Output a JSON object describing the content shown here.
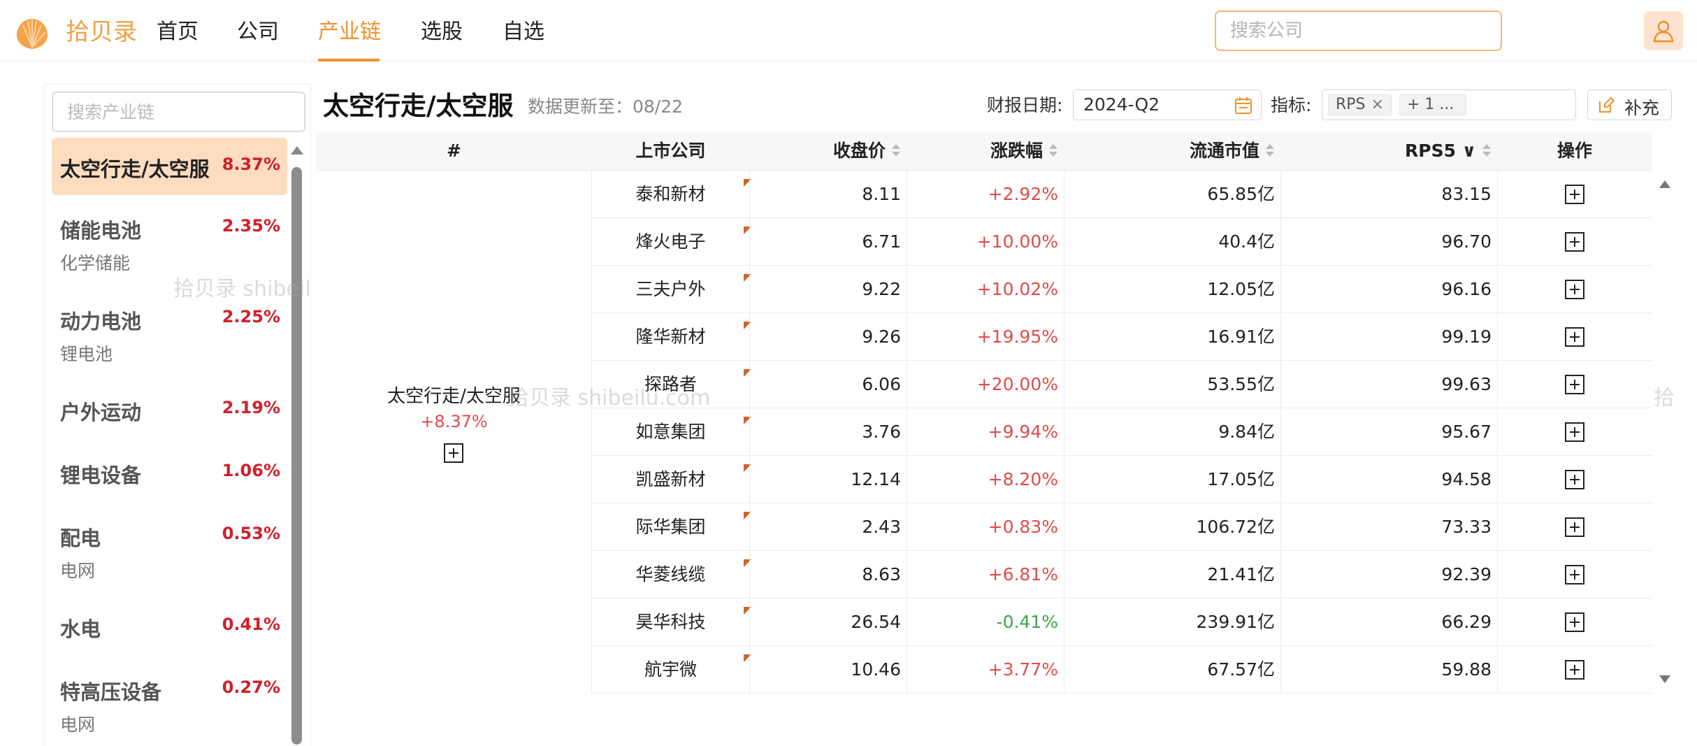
{
  "header": {
    "brand": "拾贝录",
    "nav": [
      "首页",
      "公司",
      "产业链",
      "选股",
      "自选"
    ],
    "active_nav": "产业链",
    "search_placeholder": "搜索公司",
    "accent_color": "#f0922e"
  },
  "sidebar": {
    "search_placeholder": "搜索产业链",
    "items": [
      {
        "name": "太空行走/太空服",
        "pct": "8.37%",
        "sub": "",
        "active": true
      },
      {
        "name": "储能电池",
        "pct": "2.35%",
        "sub": "化学储能"
      },
      {
        "name": "动力电池",
        "pct": "2.25%",
        "sub": "锂电池"
      },
      {
        "name": "户外运动",
        "pct": "2.19%",
        "sub": ""
      },
      {
        "name": "锂电设备",
        "pct": "1.06%",
        "sub": ""
      },
      {
        "name": "配电",
        "pct": "0.53%",
        "sub": "电网"
      },
      {
        "name": "水电",
        "pct": "0.41%",
        "sub": ""
      },
      {
        "name": "特高压设备",
        "pct": "0.27%",
        "sub": "电网"
      }
    ]
  },
  "watermarks": [
    "拾贝录 shibeilu",
    "拾贝录 shibeilu.com",
    "拾"
  ],
  "main": {
    "title": "太空行走/太空服",
    "update_label": "数据更新至：08/22",
    "report_date_label": "财报日期:",
    "report_date_value": "2024-Q2",
    "metric_label": "指标:",
    "metric_tags": [
      "RPS",
      "+ 1 ..."
    ],
    "tag_remove": "×",
    "supplement_label": "补充"
  },
  "table": {
    "columns": [
      "#",
      "上市公司",
      "收盘价",
      "涨跌幅",
      "流通市值",
      "RPS5 ∨",
      "操作"
    ],
    "group": {
      "name": "太空行走/太空服",
      "pct": "+8.37%"
    },
    "rows": [
      {
        "company": "泰和新材",
        "price": "8.11",
        "change": "+2.92%",
        "cap": "65.85亿",
        "rps": "83.15",
        "trend": "up"
      },
      {
        "company": "烽火电子",
        "price": "6.71",
        "change": "+10.00%",
        "cap": "40.4亿",
        "rps": "96.70",
        "trend": "up"
      },
      {
        "company": "三夫户外",
        "price": "9.22",
        "change": "+10.02%",
        "cap": "12.05亿",
        "rps": "96.16",
        "trend": "up"
      },
      {
        "company": "隆华新材",
        "price": "9.26",
        "change": "+19.95%",
        "cap": "16.91亿",
        "rps": "99.19",
        "trend": "up"
      },
      {
        "company": "探路者",
        "price": "6.06",
        "change": "+20.00%",
        "cap": "53.55亿",
        "rps": "99.63",
        "trend": "up"
      },
      {
        "company": "如意集团",
        "price": "3.76",
        "change": "+9.94%",
        "cap": "9.84亿",
        "rps": "95.67",
        "trend": "up"
      },
      {
        "company": "凯盛新材",
        "price": "12.14",
        "change": "+8.20%",
        "cap": "17.05亿",
        "rps": "94.58",
        "trend": "up"
      },
      {
        "company": "际华集团",
        "price": "2.43",
        "change": "+0.83%",
        "cap": "106.72亿",
        "rps": "73.33",
        "trend": "up"
      },
      {
        "company": "华菱线缆",
        "price": "8.63",
        "change": "+6.81%",
        "cap": "21.41亿",
        "rps": "92.39",
        "trend": "up"
      },
      {
        "company": "昊华科技",
        "price": "26.54",
        "change": "-0.41%",
        "cap": "239.91亿",
        "rps": "66.29",
        "trend": "down"
      },
      {
        "company": "航宇微",
        "price": "10.46",
        "change": "+3.77%",
        "cap": "67.57亿",
        "rps": "59.88",
        "trend": "up"
      }
    ]
  },
  "colors": {
    "up": "#e04b4b",
    "down": "#3aa64c",
    "sidebar_pct": "#d0202a",
    "active_bg": "#fddcbf"
  }
}
